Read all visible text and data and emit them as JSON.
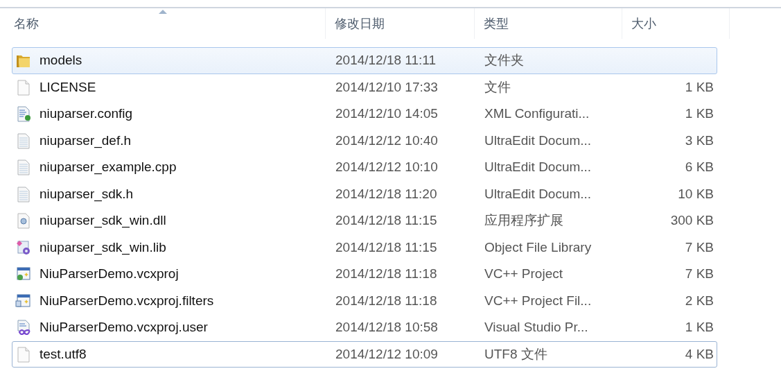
{
  "columns": [
    {
      "label": "名称",
      "sorted": true
    },
    {
      "label": "修改日期",
      "sorted": false
    },
    {
      "label": "类型",
      "sorted": false
    },
    {
      "label": "大小",
      "sorted": false
    }
  ],
  "files": [
    {
      "kind": "folder",
      "name": "models",
      "modified": "2014/12/18 11:11",
      "type": "文件夹",
      "selected": true,
      "focused": false
    },
    {
      "kind": "blank",
      "name": "LICENSE",
      "modified": "2014/12/10 17:33",
      "type": "文件",
      "size": "1 KB",
      "selected": false,
      "focused": false
    },
    {
      "kind": "config",
      "name": "niuparser.config",
      "modified": "2014/12/10 14:05",
      "type": "XML Configurati...",
      "size": "1 KB",
      "selected": false,
      "focused": false
    },
    {
      "kind": "text",
      "name": "niuparser_def.h",
      "modified": "2014/12/12 10:40",
      "type": "UltraEdit Docum...",
      "size": "3 KB",
      "selected": false,
      "focused": false
    },
    {
      "kind": "text",
      "name": "niuparser_example.cpp",
      "modified": "2014/12/12 10:10",
      "type": "UltraEdit Docum...",
      "size": "6 KB",
      "selected": false,
      "focused": false
    },
    {
      "kind": "text",
      "name": "niuparser_sdk.h",
      "modified": "2014/12/18 11:20",
      "type": "UltraEdit Docum...",
      "size": "10 KB",
      "selected": false,
      "focused": false
    },
    {
      "kind": "dll",
      "name": "niuparser_sdk_win.dll",
      "modified": "2014/12/18 11:15",
      "type": "应用程序扩展",
      "size": "300 KB",
      "selected": false,
      "focused": false
    },
    {
      "kind": "lib",
      "name": "niuparser_sdk_win.lib",
      "modified": "2014/12/18 11:15",
      "type": "Object File Library",
      "size": "7 KB",
      "selected": false,
      "focused": false
    },
    {
      "kind": "project",
      "name": "NiuParserDemo.vcxproj",
      "modified": "2014/12/18 11:18",
      "type": "VC++ Project",
      "size": "7 KB",
      "selected": false,
      "focused": false
    },
    {
      "kind": "filters",
      "name": "NiuParserDemo.vcxproj.filters",
      "modified": "2014/12/18 11:18",
      "type": "VC++ Project Fil...",
      "size": "2 KB",
      "selected": false,
      "focused": false
    },
    {
      "kind": "vsuser",
      "name": "NiuParserDemo.vcxproj.user",
      "modified": "2014/12/18 10:58",
      "type": "Visual Studio Pr...",
      "size": "1 KB",
      "selected": false,
      "focused": false
    },
    {
      "kind": "blank",
      "name": "test.utf8",
      "modified": "2014/12/12 10:09",
      "type": "UTF8 文件",
      "size": "4 KB",
      "selected": false,
      "focused": true
    }
  ]
}
